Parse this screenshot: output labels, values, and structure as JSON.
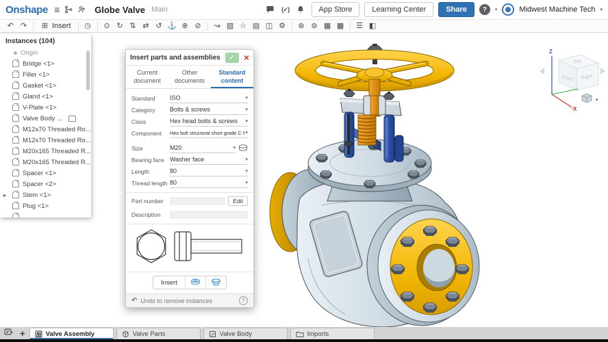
{
  "topbar": {
    "logo": "Onshape",
    "document_title": "Globe Valve",
    "workspace": "Main",
    "app_store": "App Store",
    "learning_center": "Learning Center",
    "share": "Share",
    "user_name": "Midwest Machine Tech"
  },
  "glyphs": {
    "hamburger": "≡",
    "undo": "↶",
    "redo": "↷",
    "insert": "⊞",
    "caret": "▾",
    "check": "✓",
    "close": "×",
    "braces": "{✓}",
    "chevron": "▸",
    "help": "?",
    "question": "?",
    "plus": "+"
  },
  "toolbar": {
    "insert_label": "Insert",
    "icons": [
      {
        "name": "history-icon",
        "glyph": "◷"
      },
      {
        "name": "mate-icon",
        "glyph": "⊙"
      },
      {
        "name": "revolute-mate-icon",
        "glyph": "↻"
      },
      {
        "name": "slider-mate-icon",
        "glyph": "⇅"
      },
      {
        "name": "planar-mate-icon",
        "glyph": "⇄"
      },
      {
        "name": "cylindrical-mate-icon",
        "glyph": "↺"
      },
      {
        "name": "fastened-mate-icon",
        "glyph": "⚓"
      },
      {
        "name": "ball-mate-icon",
        "glyph": "⊕"
      },
      {
        "name": "pin-slot-mate-icon",
        "glyph": "⊘"
      },
      {
        "name": "snap-mode-icon",
        "glyph": "↝"
      },
      {
        "name": "explode-view-icon",
        "glyph": "▧"
      },
      {
        "name": "named-views-icon",
        "glyph": "☆"
      },
      {
        "name": "display-states-icon",
        "glyph": "▤"
      },
      {
        "name": "named-positions-icon",
        "glyph": "◫"
      },
      {
        "name": "assembly-features-icon",
        "glyph": "⚙"
      },
      {
        "name": "gear-relation-icon",
        "glyph": "⊛"
      },
      {
        "name": "screw-relation-icon",
        "glyph": "⊚"
      },
      {
        "name": "rack-pinion-relation-icon",
        "glyph": "▦"
      },
      {
        "name": "replicate-icon",
        "glyph": "▩"
      },
      {
        "name": "bom-icon",
        "glyph": "☰"
      },
      {
        "name": "measure-icon",
        "glyph": "◧"
      }
    ]
  },
  "instances": {
    "header": "Instances (104)",
    "items": [
      {
        "label": "Origin"
      },
      {
        "label": "Bridge <1>"
      },
      {
        "label": "Filler <1>"
      },
      {
        "label": "Gasket <1>"
      },
      {
        "label": "Gland <1>"
      },
      {
        "label": "V-Plate <1>"
      },
      {
        "label": "Valve Body ..."
      },
      {
        "label": "M12x70 Threaded Ro..."
      },
      {
        "label": "M12x70 Threaded Ro..."
      },
      {
        "label": "M20x165 Threaded R..."
      },
      {
        "label": "M20x165 Threaded R..."
      },
      {
        "label": "Spacer <1>"
      },
      {
        "label": "Spacer <2>"
      },
      {
        "label": "Stem <1>"
      },
      {
        "label": "Plug <1>"
      },
      {
        "label": ""
      }
    ]
  },
  "dialog": {
    "title": "Insert parts and assemblies",
    "tabs": [
      {
        "label": "Current document"
      },
      {
        "label": "Other documents"
      },
      {
        "label": "Standard content"
      }
    ],
    "fields": [
      {
        "label": "Standard",
        "value": "ISO"
      },
      {
        "label": "Category",
        "value": "Bolts & screws"
      },
      {
        "label": "Class",
        "value": "Hex head bolts & screws"
      },
      {
        "label": "Component",
        "value": "Hex bolt structural short grade C ISC"
      },
      {
        "label": "Size",
        "value": "M20"
      },
      {
        "label": "Bearing face",
        "value": "Washer face"
      },
      {
        "label": "Length",
        "value": "80"
      },
      {
        "label": "Thread length",
        "value": "80"
      }
    ],
    "part_number_label": "Part number",
    "description_label": "Description",
    "edit_button": "Edit",
    "insert_button": "Insert",
    "footer_note": "Undo to remove instances"
  },
  "viewcube": {
    "top": "Top",
    "front": "Front",
    "right": "Right",
    "z": "Z",
    "x": "X"
  },
  "tabs": {
    "items": [
      {
        "label": "Valve Assembly",
        "active": true
      },
      {
        "label": "Valve Parts",
        "active": false
      },
      {
        "label": "Valve Body",
        "active": false
      },
      {
        "label": "Imports",
        "active": false
      }
    ]
  },
  "colors": {
    "accent_blue": "#2a6db3",
    "share_blue": "#2f72b4",
    "handwheel_yellow": "#f2b705",
    "stem_orange": "#e8920c",
    "yoke_pillar_blue": "#2b52a8",
    "body_steel": "#cfdbe3",
    "bolt_gray": "#7b8593",
    "close_red": "#cf3430"
  }
}
